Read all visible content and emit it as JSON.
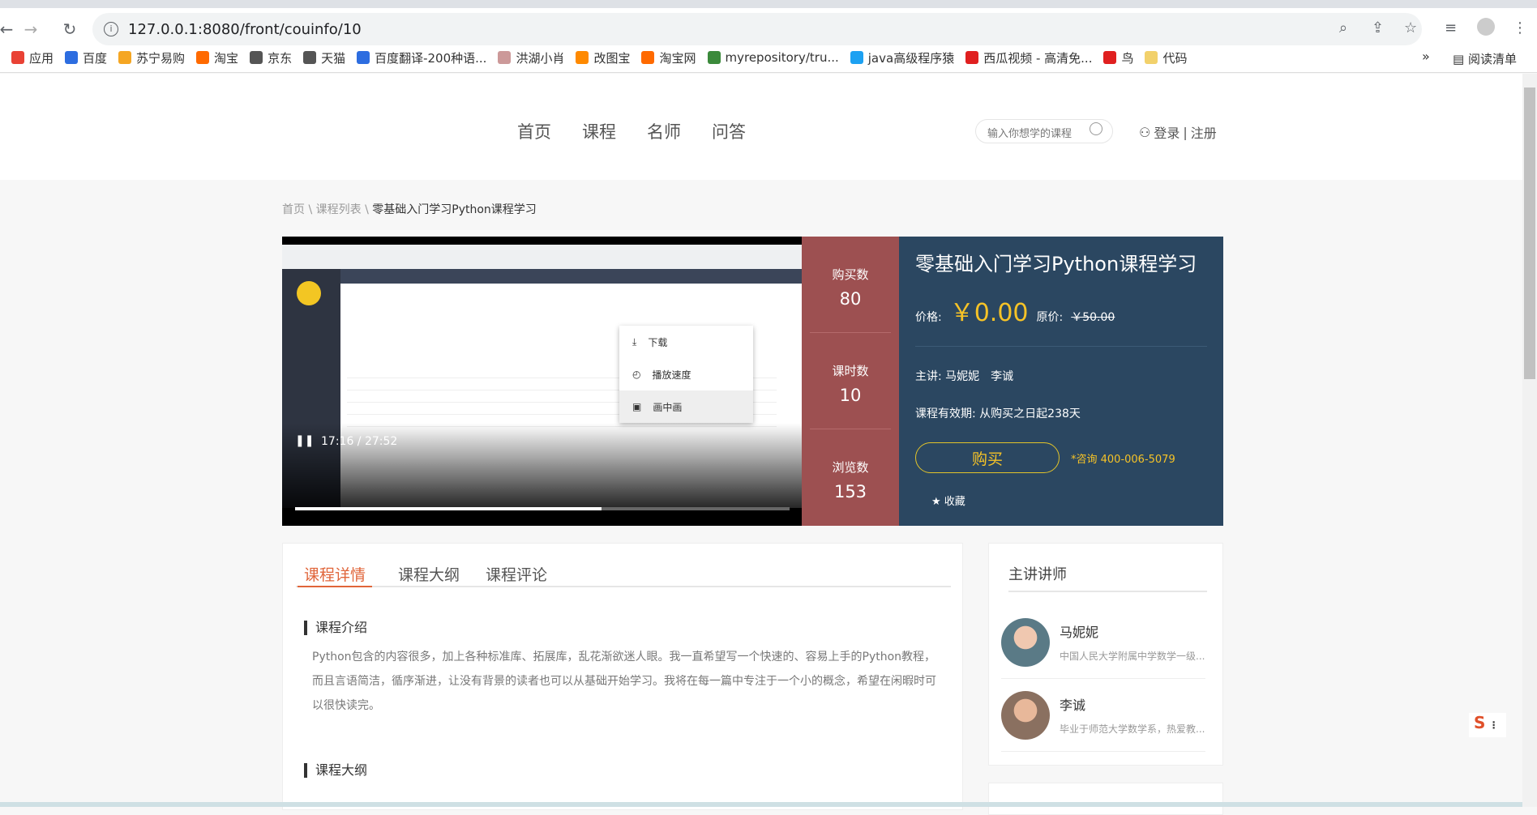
{
  "browser": {
    "url": "127.0.0.1:8080/front/couinfo/10",
    "bookmarks": [
      "应用",
      "百度",
      "苏宁易购",
      "淘宝",
      "京东",
      "天猫",
      "百度翻译-200种语...",
      "洪湖小肖",
      "改图宝",
      "淘宝网",
      "myrepository/tru...",
      "java高级程序猿",
      "西瓜视频 - 高清免...",
      "鸟",
      "代码"
    ],
    "bookmark_colors": [
      "#e94235",
      "#2d6de0",
      "#f5a623",
      "#ff6a00",
      "#555",
      "#555",
      "#2d6de0",
      "#c99",
      "#ff8a00",
      "#ff6a00",
      "#3b8a3b",
      "#1da1f2",
      "#e02020",
      "#e02020",
      "#f2d16b"
    ],
    "reading_list": "阅读清单",
    "more": "»"
  },
  "header": {
    "nav": [
      "首页",
      "课程",
      "名师",
      "问答"
    ],
    "search_placeholder": "输入你想学的课程",
    "login": "登录",
    "sep": "|",
    "register": "注册"
  },
  "breadcrumb": {
    "items": [
      "首页",
      "课程列表"
    ],
    "sep": "\\",
    "current": "零基础入门学习Python课程学习"
  },
  "video": {
    "time": "17:16 / 27:52",
    "progress": 0.62,
    "menu": [
      "下载",
      "播放速度",
      "画中画"
    ]
  },
  "stats": [
    {
      "label": "购买数",
      "value": "80"
    },
    {
      "label": "课时数",
      "value": "10"
    },
    {
      "label": "浏览数",
      "value": "153"
    }
  ],
  "course": {
    "title": "零基础入门学习Python课程学习",
    "price_label": "价格:",
    "price": "￥0.00",
    "orig_label": "原价:",
    "orig": "￥50.00",
    "teacher_label": "主讲:",
    "teachers": "马妮妮　李诚",
    "valid_label": "课程有效期:",
    "valid": "从购买之日起238天",
    "buy": "购买",
    "consult": "*咨询 400-006-5079",
    "fav": "收藏"
  },
  "tabs": [
    "课程详情",
    "课程大纲",
    "课程评论"
  ],
  "intro": {
    "heading": "课程介绍",
    "text": "Python包含的内容很多，加上各种标准库、拓展库，乱花渐欲迷人眼。我一直希望写一个快速的、容易上手的Python教程，而且言语简洁，循序渐进，让没有背景的读者也可以从基础开始学习。我将在每一篇中专注于一个小的概念，希望在闲暇时可以很快读完。"
  },
  "outline": {
    "heading": "课程大纲"
  },
  "lecturers": {
    "title": "主讲讲师",
    "items": [
      {
        "name": "马妮妮",
        "desc": "中国人民大学附属中学数学一级..."
      },
      {
        "name": "李诚",
        "desc": "毕业于师范大学数学系，热爱教..."
      }
    ]
  },
  "colors": {
    "accent": "#e0653a",
    "stats_bg": "#9d5051",
    "info_bg": "#2b4761",
    "gold": "#f6c327"
  }
}
